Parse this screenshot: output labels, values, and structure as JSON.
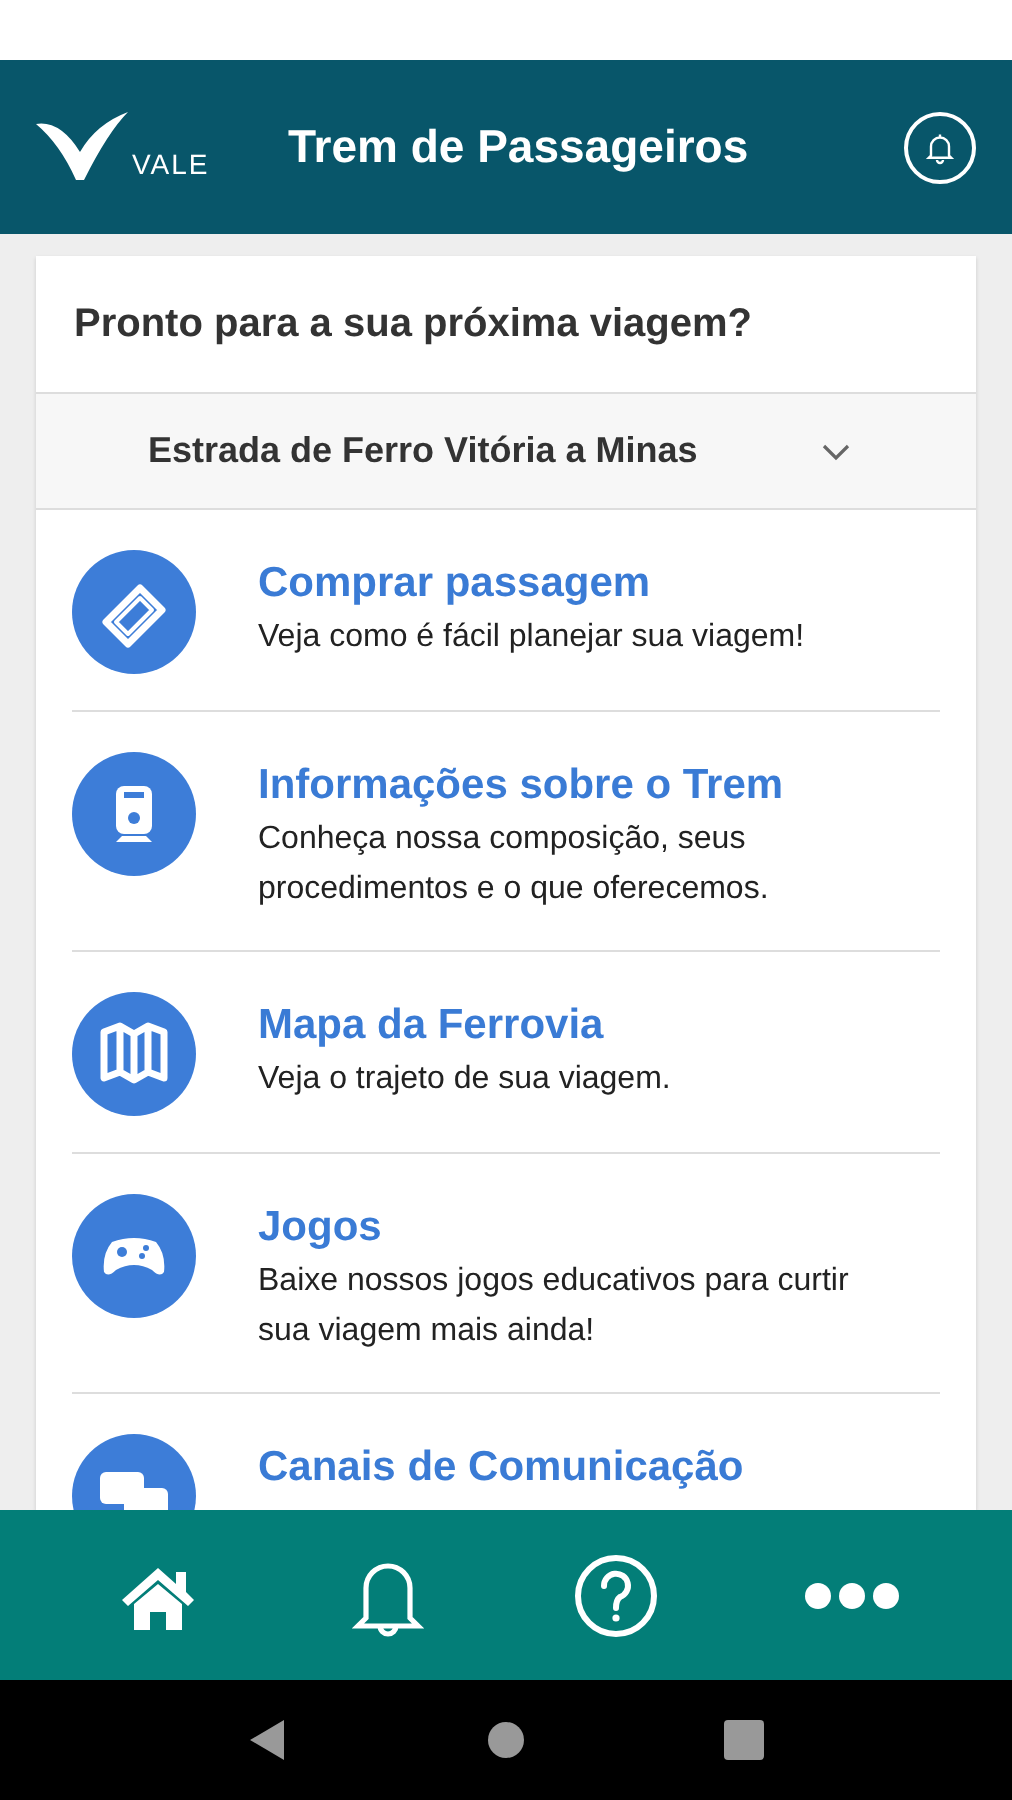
{
  "header": {
    "logo_text": "VALE",
    "title": "Trem de Passageiros"
  },
  "card": {
    "heading": "Pronto para a sua próxima viagem?",
    "dropdown": {
      "value": "Estrada de Ferro Vitória a Minas"
    },
    "items": [
      {
        "kind": "ticket",
        "title": "Comprar passagem",
        "description": "Veja como é fácil planejar sua viagem!"
      },
      {
        "kind": "train",
        "title": "Informações sobre o Trem",
        "description": "Conheça nossa composição, seus procedimentos e o que oferecemos."
      },
      {
        "kind": "map",
        "title": "Mapa da Ferrovia",
        "description": "Veja o trajeto de sua viagem."
      },
      {
        "kind": "gamepad",
        "title": "Jogos",
        "description": "Baixe nossos jogos educativos para curtir sua viagem mais ainda!"
      },
      {
        "kind": "chat",
        "title": "Canais de Comunicação"
      }
    ]
  },
  "bottom_nav": [
    {
      "kind": "home"
    },
    {
      "kind": "bell"
    },
    {
      "kind": "help"
    },
    {
      "kind": "more"
    }
  ]
}
